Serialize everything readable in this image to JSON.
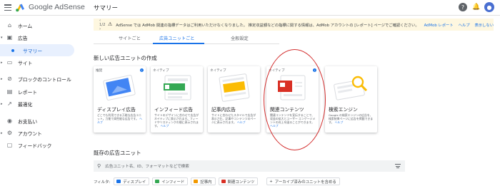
{
  "topbar": {
    "brand": "Google AdSense",
    "page_title": "サマリー",
    "help_icon": "help-icon",
    "bell_icon": "bell-icon",
    "avatar_initial": "👤"
  },
  "sidebar": {
    "items": [
      {
        "label": "ホーム",
        "icon": "home-icon"
      },
      {
        "label": "広告",
        "icon": "ads-icon"
      },
      {
        "label": "サマリー",
        "icon": "dot"
      },
      {
        "label": "サイト",
        "icon": "sites-icon"
      },
      {
        "label": "ブロックのコントロール",
        "icon": "block-icon"
      },
      {
        "label": "レポート",
        "icon": "report-icon"
      },
      {
        "label": "最適化",
        "icon": "optimize-icon"
      },
      {
        "label": "お支払い",
        "icon": "payments-icon"
      },
      {
        "label": "アカウント",
        "icon": "account-icon"
      },
      {
        "label": "フィードバック",
        "icon": "feedback-icon"
      }
    ]
  },
  "banner": {
    "pager": "1/2",
    "message": "AdSense では AdMob 関連の指標データはご利用いただけなくなりました。 推定収益額などの指標に関する情報は、AdMob アカウントの [レポート] ページでご確認ください。",
    "links": [
      "AdMob レポート",
      "ヘルプ",
      "表示しない"
    ]
  },
  "tabs": [
    {
      "label": "サイトごと"
    },
    {
      "label": "広告ユニットごと"
    },
    {
      "label": "全般設定"
    }
  ],
  "new_units": {
    "title": "新しい広告ユニットの作成",
    "cards": [
      {
        "tag": "推奨",
        "title": "ディスプレイ広告",
        "desc": "どこでも利用できる万能な広告ユニット。万能で高性能な広告です。",
        "more": "ヘルプ"
      },
      {
        "tag": "ネイティブ",
        "title": "インフィード広告",
        "desc": "サイトのデザインに合わせて広告がネイティブに表示されます。フィードやリスティングの間に表示されます。",
        "more": "ヘルプ"
      },
      {
        "tag": "ネイティブ",
        "title": "記事内広告",
        "desc": "サイトに合わせたスタイルで広告が表示され、記事やコンテンツのページに表示されます。",
        "more": "ヘルプ"
      },
      {
        "tag": "ネイティブ",
        "title": "関連コンテンツ",
        "desc": "関連コンテンツを宣伝することで、収益の拡大とユーザー エンゲージメントの向上を図ることができます。",
        "more": "ヘルプ"
      },
      {
        "tag": "",
        "title": "検索エンジン",
        "desc": "Google の検索エンジンの広告を、検索結果ページに広告を掲載できます。",
        "more": "ヘルプ"
      }
    ]
  },
  "existing": {
    "title": "既存の広告ユニット",
    "search_placeholder": "広告ユニット名、ID、フォーマットなどで検索",
    "filter_label": "フィルタ:",
    "chips": [
      {
        "label": "ディスプレイ",
        "color": "#1a73e8"
      },
      {
        "label": "インフィード",
        "color": "#34a853"
      },
      {
        "label": "記事内",
        "color": "#f29900"
      },
      {
        "label": "関連コンテンツ",
        "color": "#d93025"
      }
    ],
    "archive_label": "アーカイブ済みのユニットを含める"
  },
  "colors": {
    "accent": "#1a73e8",
    "highlight_circle": "#d32f2f",
    "banner_bg": "#fef7e0"
  }
}
